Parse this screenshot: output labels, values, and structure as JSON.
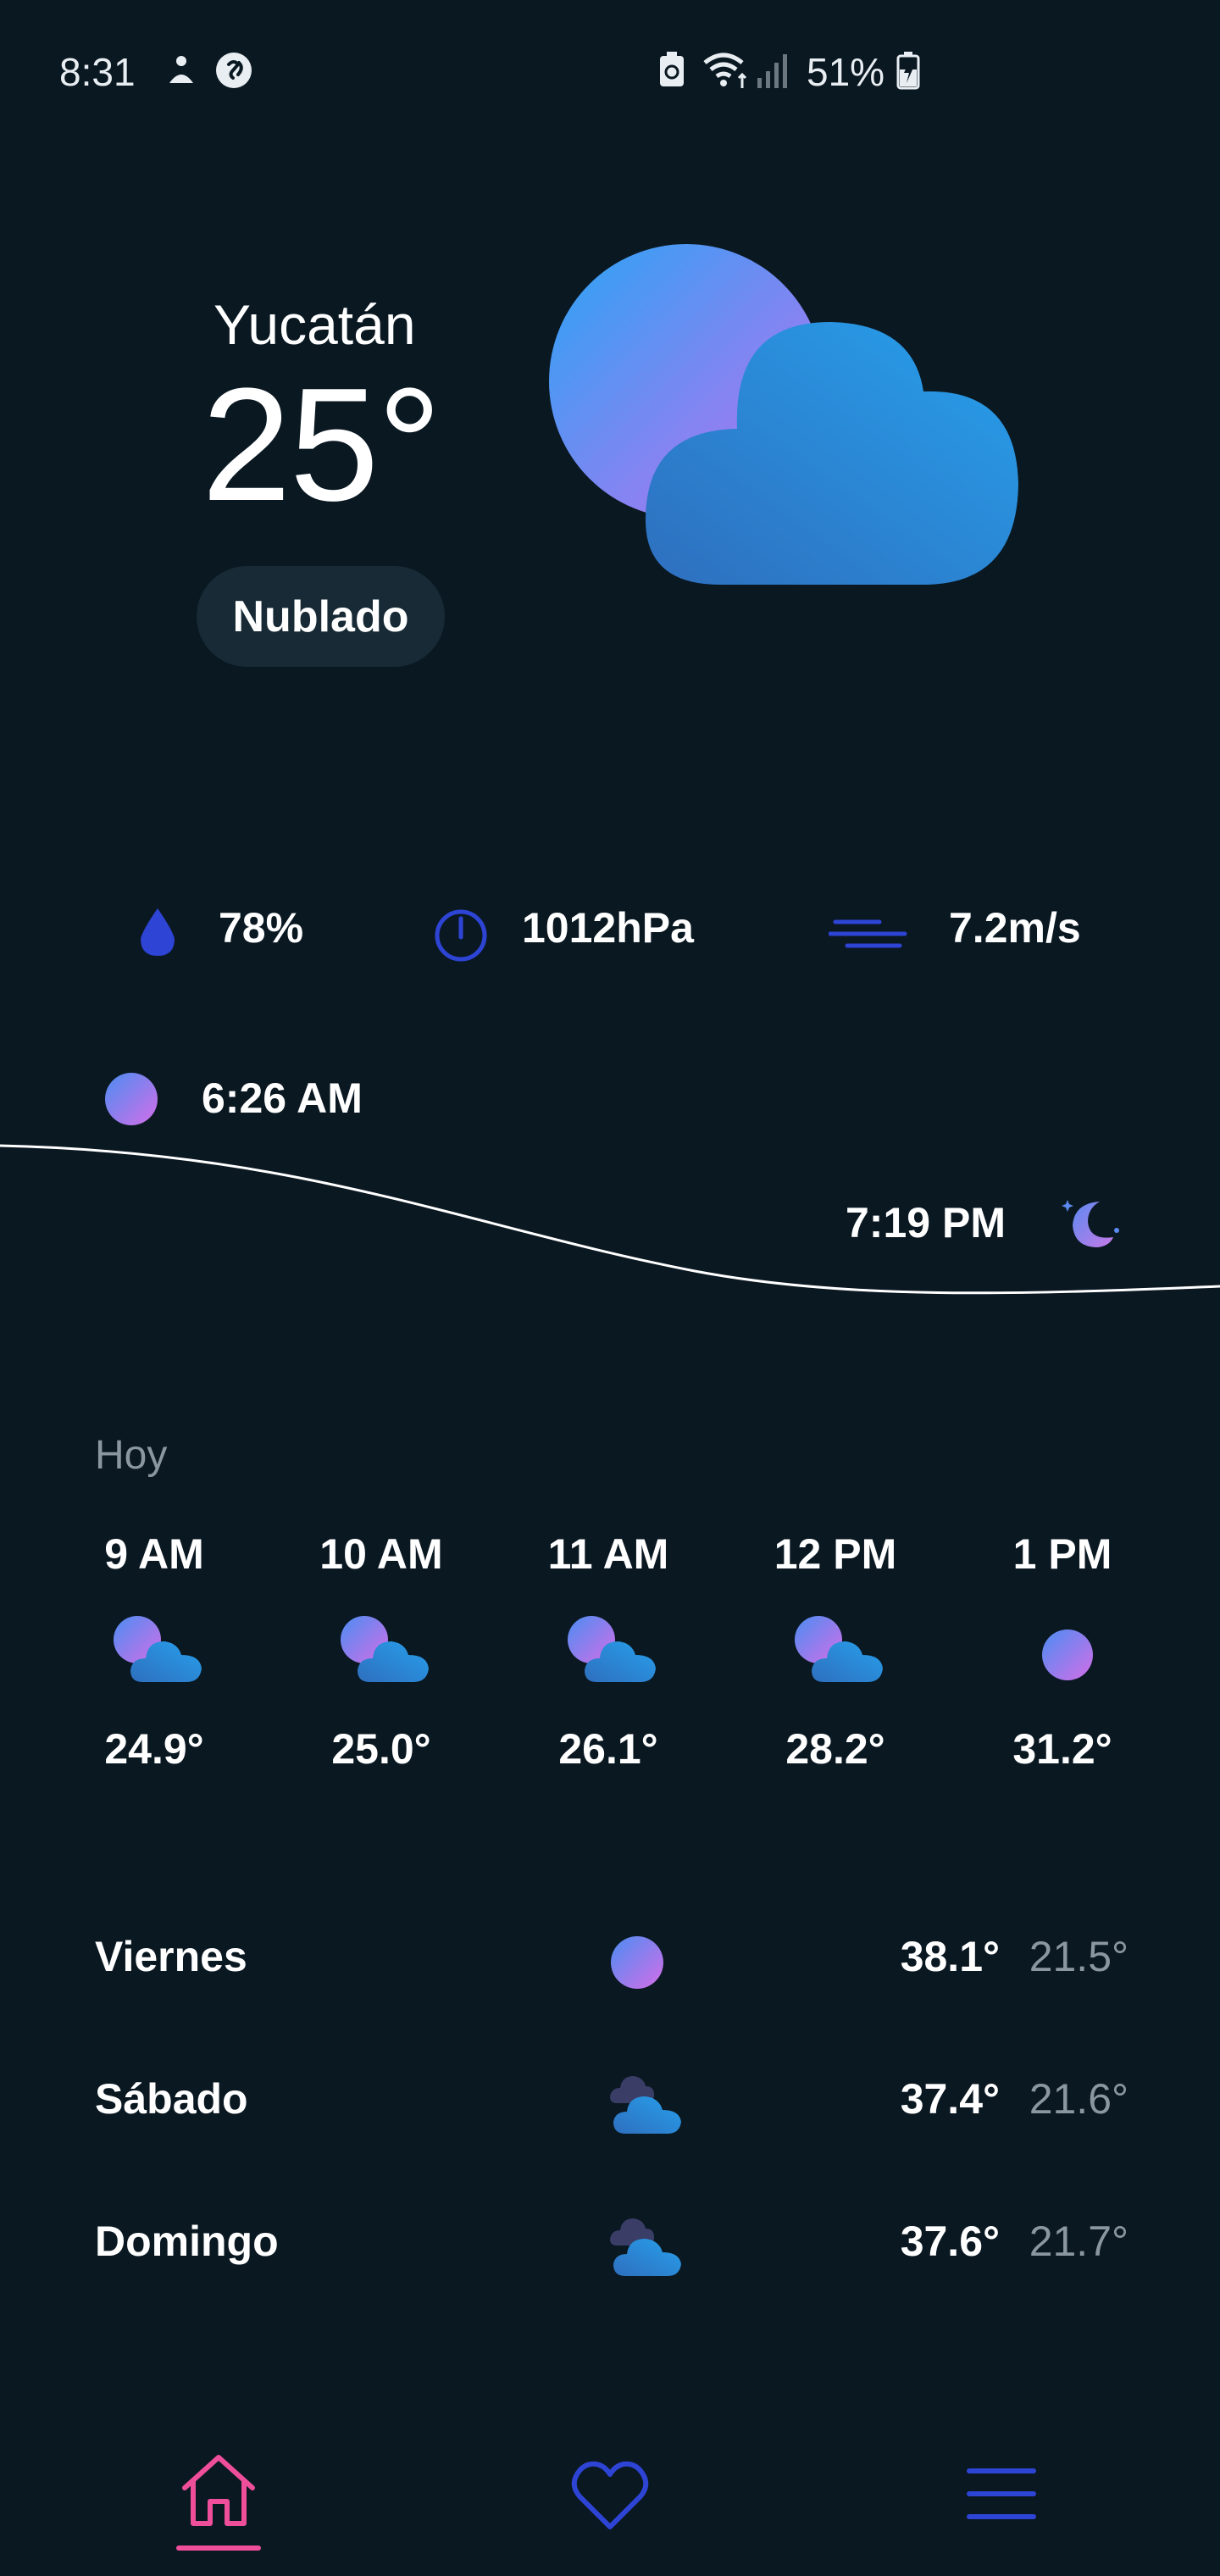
{
  "status_bar": {
    "time": "8:31",
    "battery": "51%"
  },
  "current": {
    "city": "Yucatán",
    "temperature": "25°",
    "condition": "Nublado"
  },
  "stats": {
    "humidity": "78%",
    "pressure": "1012hPa",
    "wind": "7.2m/s"
  },
  "sun": {
    "sunrise": "6:26 AM",
    "sunset": "7:19 PM"
  },
  "today": {
    "label": "Hoy",
    "hours": [
      {
        "time": "9 AM",
        "temp": "24.9°",
        "icon": "partly-cloudy-icon"
      },
      {
        "time": "10 AM",
        "temp": "25.0°",
        "icon": "partly-cloudy-icon"
      },
      {
        "time": "11 AM",
        "temp": "26.1°",
        "icon": "partly-cloudy-icon"
      },
      {
        "time": "12 PM",
        "temp": "28.2°",
        "icon": "partly-cloudy-icon"
      },
      {
        "time": "1 PM",
        "temp": "31.2°",
        "icon": "sun-icon"
      }
    ]
  },
  "forecast": [
    {
      "day": "Viernes",
      "max": "38.1°",
      "min": "21.5°",
      "icon": "sun-icon"
    },
    {
      "day": "Sábado",
      "max": "37.4°",
      "min": "21.6°",
      "icon": "cloudy-icon"
    },
    {
      "day": "Domingo",
      "max": "37.6°",
      "min": "21.7°",
      "icon": "cloudy-icon"
    }
  ],
  "colors": {
    "background": "#0a1822",
    "accent_pink": "#ee4e9a",
    "accent_blue": "#2d44d4",
    "muted_text": "#8a96a0"
  }
}
